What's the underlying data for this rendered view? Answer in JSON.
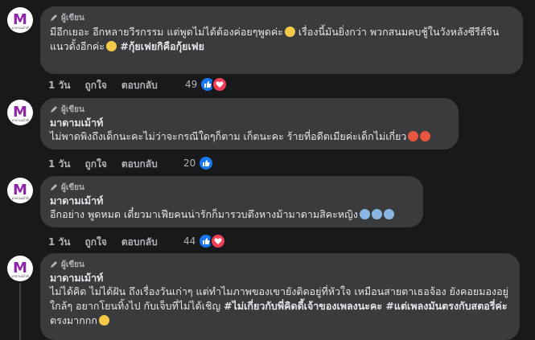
{
  "comments": [
    {
      "badge": "ผู้เขียน",
      "author": "",
      "text_parts": [
        {
          "t": "มีอีกเยอะ อีกหลายวีรกรรม แต่พูดไม่ได้ต้องค่อยๆพูดค่ะ",
          "bold": false
        },
        {
          "emoji": "shushing-face"
        },
        {
          "t": " เรื่องนี้มันยิ่งกว่า พวกสนมคบชู้ในวังหลังซีรีส์จีนแนวดั้งอีกค่ะ",
          "bold": false
        },
        {
          "emoji": "grinning-face"
        },
        {
          "t": " #กุ้ยเฟยกิคือกุ้ยเฟย",
          "bold": true
        }
      ],
      "time": "1 วัน",
      "like": "ถูกใจ",
      "reply": "ตอบกลับ",
      "reaction_count": "49"
    },
    {
      "badge": "ผู้เขียน",
      "author": "มาดามเม้าท์",
      "text_parts": [
        {
          "t": "ไม่พาดพิงถึงเด็กนะคะไม่ว่าจะกรณีใดๆก็ตาม เก็ตนะคะ ร้ายที่อดีตเมียค่ะเด็กไม่เกี่ยว",
          "bold": false
        },
        {
          "emoji": "angry-face"
        },
        {
          "emoji": "angry-face"
        }
      ],
      "time": "1 วัน",
      "like": "ถูกใจ",
      "reply": "ตอบกลับ",
      "reaction_count": "20"
    },
    {
      "badge": "ผู้เขียน",
      "author": "มาดามเม้าท์",
      "text_parts": [
        {
          "t": "อีกอย่าง พูดหมด เดี๋ยวมาเฟียคนน่ารักก็มารวบตึงหางม้ามาดามสิคะหญิง",
          "bold": false
        },
        {
          "emoji": "fearful-face"
        },
        {
          "emoji": "fearful-face"
        },
        {
          "emoji": "fearful-face"
        }
      ],
      "time": "1 วัน",
      "like": "ถูกใจ",
      "reply": "ตอบกลับ",
      "reaction_count": "44"
    },
    {
      "badge": "ผู้เขียน",
      "author": "มาดามเม้าท์",
      "text_parts": [
        {
          "t": "ไม่ได้คิด ไม่ได้ฝัน ถึงเรื่องวันเก่าๆ แต่ทำไมภาพของเขายังติดอยู่ที่หัวใจ เหมือนสายตาเธอจ้อง ยังคอยมองอยู่ใกล้ๆ อยากโยนทิ้งไป กับเจ็บที่ไม่ได้เชิญ ",
          "bold": false
        },
        {
          "t": "#ไม่เกี่ยวกับพี่คิดดี้เจ้าของเพลงนะคะ #แต่เพลงมันตรงกับสตอรี่ค่ะ",
          "bold": true
        },
        {
          "t": " ตรงมากกก",
          "bold": false
        },
        {
          "emoji": "smirking-face"
        }
      ]
    }
  ],
  "avatar_letter": "M",
  "avatar_caption": "มาดามเม้าท์",
  "colors": {
    "brand": "#8e24aa",
    "like": "#1877f2",
    "love": "#f33e58",
    "bubble": "#3a3b3c"
  }
}
